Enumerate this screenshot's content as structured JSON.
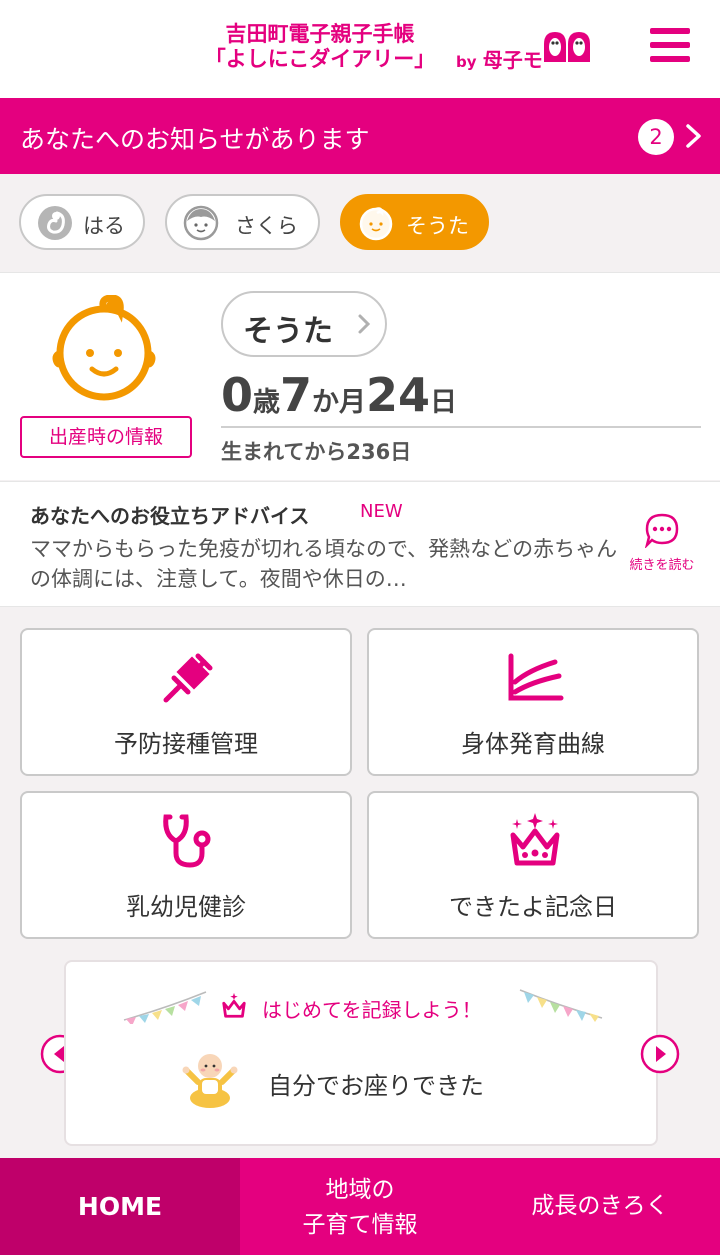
{
  "header": {
    "title_line1": "吉田町電子親子手帳",
    "title_line2": "「よしにこダイアリー」",
    "by": "by",
    "logo_text": "母子モ",
    "menu_icon": "hamburger-icon"
  },
  "notice": {
    "text": "あなたへのお知らせがあります",
    "count": "2"
  },
  "children": [
    {
      "name": "はる",
      "icon": "fetus-icon",
      "active": false
    },
    {
      "name": "さくら",
      "icon": "girl-face-icon",
      "active": false
    },
    {
      "name": "そうた",
      "icon": "baby-face-icon",
      "active": true
    }
  ],
  "profile": {
    "name": "そうた",
    "age_years": "0",
    "age_years_unit": "歳",
    "age_months": "7",
    "age_months_unit": "か月",
    "age_days": "24",
    "age_days_unit": "日",
    "days_since_birth": "生まれてから236日",
    "birth_info_button": "出産時の情報"
  },
  "advice": {
    "title": "あなたへのお役立ちアドバイス",
    "new_badge": "NEW",
    "body": "ママからもらった免疫が切れる頃なので、発熱などの赤ちゃんの体調には、注意して。夜間や休日の…",
    "read_more": "続きを読む"
  },
  "tiles": [
    {
      "label": "予防接種管理",
      "icon": "syringe-icon"
    },
    {
      "label": "身体発育曲線",
      "icon": "growth-curve-icon"
    },
    {
      "label": "乳幼児健診",
      "icon": "stethoscope-icon"
    },
    {
      "label": "できたよ記念日",
      "icon": "crown-icon"
    }
  ],
  "milestone": {
    "heading": "はじめてを記録しよう！",
    "item": "自分でお座りできた"
  },
  "bottom_nav": {
    "home": "HOME",
    "area_line1": "地域の",
    "area_line2": "子育て情報",
    "growth": "成長のきろく"
  },
  "colors": {
    "accent": "#e4007f",
    "accent_dark": "#bf006a",
    "active_child": "#f39800"
  }
}
